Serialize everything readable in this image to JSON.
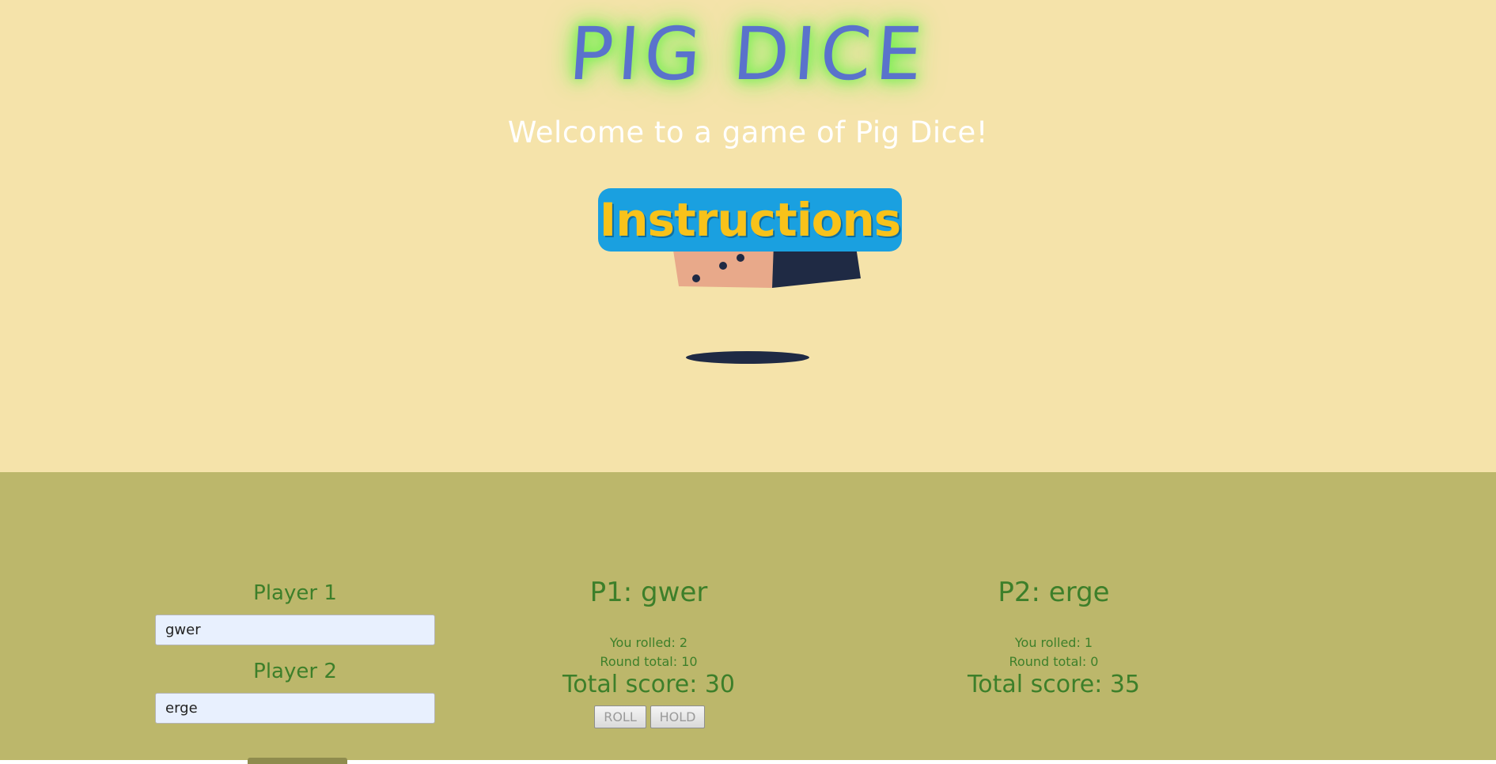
{
  "header": {
    "title": "PIG DICE",
    "welcome": "Welcome to a game of Pig Dice!",
    "instructions_label": "Instructions"
  },
  "setup": {
    "player1_label": "Player 1",
    "player1_value": "gwer",
    "player2_label": "Player 2",
    "player2_value": "erge"
  },
  "player1": {
    "name": "P1: gwer",
    "rolled": "You rolled: 2",
    "round_total": "Round total: 10",
    "total_score": "Total score: 30",
    "roll_label": "ROLL",
    "hold_label": "HOLD"
  },
  "player2": {
    "name": "P2: erge",
    "rolled": "You rolled: 1",
    "round_total": "Round total: 0",
    "total_score": "Total score: 35"
  },
  "colors": {
    "top_bg": "#f5e3aa",
    "bottom_bg": "#bcb76b",
    "title": "#5a72cc",
    "title_glow": "#6ff04a",
    "text_green": "#3d7f2a",
    "instructions_bg": "#1aa0e0",
    "instructions_text": "#f8c21a"
  },
  "icons": {
    "die": "die-icon"
  }
}
